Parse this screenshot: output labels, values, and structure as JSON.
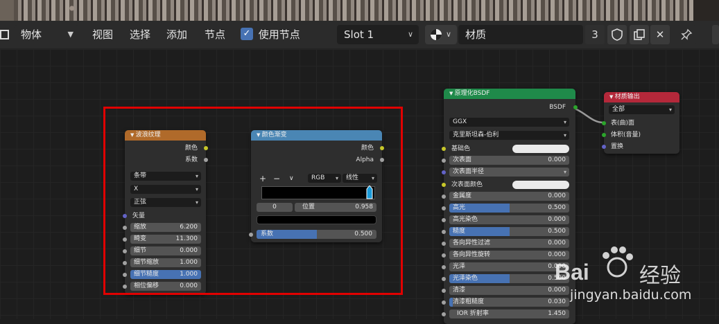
{
  "header": {
    "object_mode": "物体",
    "menu": [
      "视图",
      "选择",
      "添加",
      "节点"
    ],
    "use_nodes_label": "使用节点",
    "slot": "Slot 1",
    "material_name": "材质",
    "user_count": "3"
  },
  "nodes": {
    "wave": {
      "title": "波浪纹理",
      "outputs": [
        "颜色",
        "系数"
      ],
      "dropdowns": [
        "条带",
        "X",
        "正弦"
      ],
      "vector_label": "矢量",
      "fields": [
        {
          "label": "缩放",
          "value": "6.200"
        },
        {
          "label": "畸变",
          "value": "11.300"
        },
        {
          "label": "细节",
          "value": "0.000"
        },
        {
          "label": "细节缩放",
          "value": "1.000"
        },
        {
          "label": "细节糙度",
          "value": "1.000"
        },
        {
          "label": "相位偏移",
          "value": "0.000"
        }
      ]
    },
    "ramp": {
      "title": "颜色渐变",
      "outputs": [
        "颜色",
        "Alpha"
      ],
      "plus": "+",
      "minus": "−",
      "mode": "RGB",
      "interp": "线性",
      "stop_index": "0",
      "pos_label": "位置",
      "pos_value": "0.958",
      "fac_label": "系数",
      "fac_value": "0.500"
    },
    "bsdf": {
      "title": "原理化BSDF",
      "output": "BSDF",
      "dist": "GGX",
      "sss_method": "克里斯坦森-伯利",
      "rows": [
        {
          "label": "基础色",
          "value": ""
        },
        {
          "label": "次表面",
          "value": "0.000"
        },
        {
          "label": "次表面半径",
          "value": ""
        },
        {
          "label": "次表面颜色",
          "value": ""
        },
        {
          "label": "金属度",
          "value": "0.000"
        },
        {
          "label": "高光",
          "value": "0.500"
        },
        {
          "label": "高光染色",
          "value": "0.000"
        },
        {
          "label": "糙度",
          "value": "0.500"
        },
        {
          "label": "各向异性过滤",
          "value": "0.000"
        },
        {
          "label": "各向异性旋转",
          "value": "0.000"
        },
        {
          "label": "光泽",
          "value": "0.000"
        },
        {
          "label": "光泽染色",
          "value": "0.500"
        },
        {
          "label": "清漆",
          "value": "0.000"
        },
        {
          "label": "清漆粗糙度",
          "value": "0.030"
        },
        {
          "label": "IOR 折射率",
          "value": "1.450"
        }
      ]
    },
    "output": {
      "title": "材质输出",
      "target": "全部",
      "inputs": [
        "表(曲)面",
        "体积(音量)",
        "置换"
      ]
    }
  },
  "watermark": {
    "brand": "Bai",
    "brand2": "经验",
    "url": "jingyan.baidu.com"
  },
  "colors": {
    "wave_header": "#b06a2a",
    "ramp_header": "#4a86b4",
    "bsdf_header": "#1f8a4a",
    "output_header": "#b4283a",
    "accent": "#4772b3",
    "highlight_box": "#e10000"
  }
}
